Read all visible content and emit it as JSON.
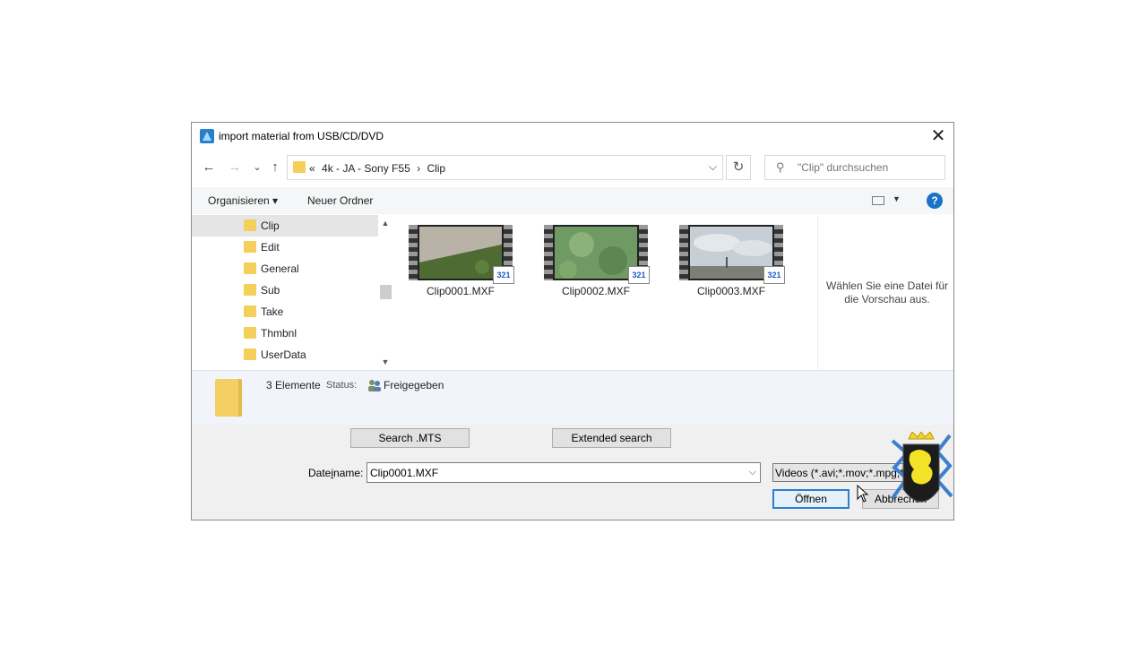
{
  "window": {
    "title": "import material from USB/CD/DVD",
    "close_glyph": "✕"
  },
  "nav": {
    "back_glyph": "←",
    "forward_glyph": "→",
    "recent_glyph": "⌄",
    "up_glyph": "↑",
    "refresh_glyph": "↻"
  },
  "address": {
    "overflow": "«",
    "crumbs": [
      "4k - JA - Sony F55",
      "›",
      "Clip"
    ],
    "dropdown_glyph": "⌵"
  },
  "search": {
    "placeholder": "\"Clip\" durchsuchen",
    "icon": "search-icon"
  },
  "toolbar": {
    "organize": "Organisieren ▾",
    "new_folder": "Neuer Ordner",
    "view_caret": "▼",
    "help": "?"
  },
  "tree": {
    "items": [
      {
        "label": "Clip",
        "selected": true
      },
      {
        "label": "Edit"
      },
      {
        "label": "General"
      },
      {
        "label": "Sub"
      },
      {
        "label": "Take"
      },
      {
        "label": "Thmbnl"
      },
      {
        "label": "UserData"
      }
    ],
    "scroll_up": "▲",
    "scroll_down": "▼"
  },
  "files": [
    {
      "name": "Clip0001.MXF",
      "badge": "321"
    },
    {
      "name": "Clip0002.MXF",
      "badge": "321"
    },
    {
      "name": "Clip0003.MXF",
      "badge": "321"
    }
  ],
  "preview": {
    "text": "Wählen Sie eine Datei für die Vorschau aus."
  },
  "details": {
    "count": "3 Elemente",
    "status_label": "Status:",
    "status_value": "Freigegeben"
  },
  "buttons": {
    "search_mts": "Search .MTS",
    "extended_search": "Extended search",
    "open": "Öffnen",
    "cancel": "Abbrechen"
  },
  "filename": {
    "label_pre": "Date",
    "label_underline": "i",
    "label_post": "name:",
    "value": "Clip0001.MXF",
    "dropdown_glyph": "⌵"
  },
  "filetype": {
    "value": "Videos (*.avi;*.mov;*.mpg;*.m"
  },
  "colors": {
    "accent": "#2c7fd0",
    "folder": "#f4cf5a",
    "help": "#1a73c6"
  }
}
